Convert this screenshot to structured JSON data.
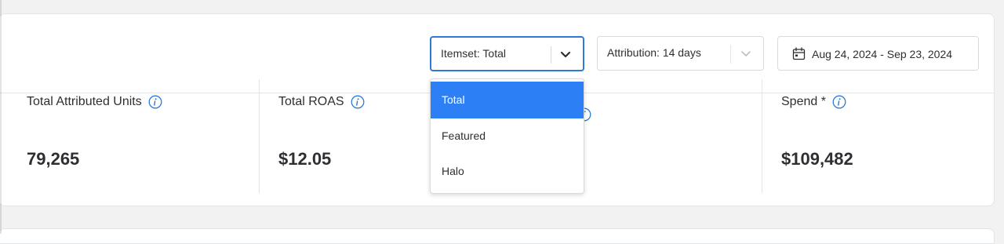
{
  "filters": {
    "itemset": {
      "label": "Itemset: Total",
      "options": [
        "Total",
        "Featured",
        "Halo"
      ],
      "selected": "Total"
    },
    "attribution": {
      "label": "Attribution: 14 days"
    },
    "date_range": {
      "label": "Aug 24, 2024 - Sep 23, 2024"
    }
  },
  "metrics": [
    {
      "title": "Total Attributed Units",
      "value": "79,265"
    },
    {
      "title": "Total ROAS",
      "value": "$12.05"
    },
    {
      "title": "",
      "value": ""
    },
    {
      "title": "Spend *",
      "value": "$109,482"
    }
  ],
  "icons": {
    "info": "info-circle-icon",
    "calendar": "calendar-icon",
    "chevron": "chevron-down-icon"
  },
  "colors": {
    "accent": "#2d7ff5",
    "focus_border": "#2d7ad6",
    "info_icon": "#2d7ad6"
  }
}
